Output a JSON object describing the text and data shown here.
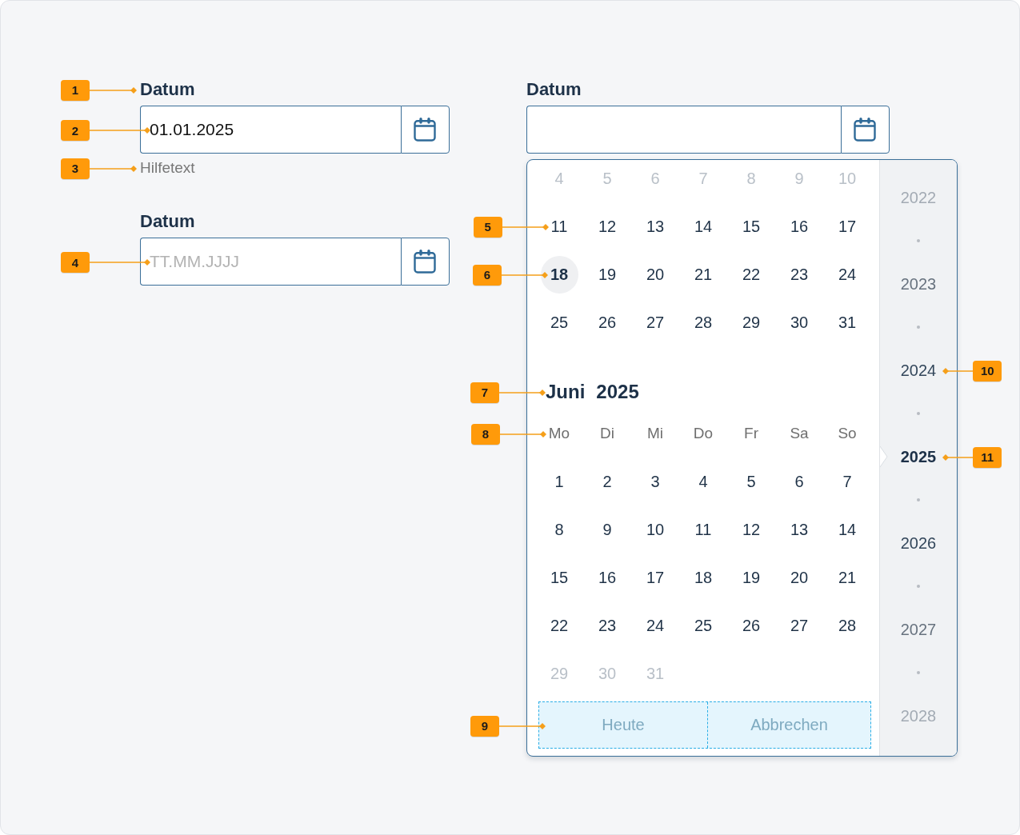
{
  "columns": [
    {
      "fields": [
        {
          "label": "Datum",
          "label_callout": "1",
          "value": "01.01.2025",
          "value_callout": "2",
          "helper": "Hilfetext",
          "helper_callout": "3"
        },
        {
          "label": "Datum",
          "placeholder": "TT.MM.JJJJ",
          "placeholder_callout": "4"
        }
      ]
    },
    {
      "fields": [
        {
          "label": "Datum",
          "calendar": {
            "months": [
              {
                "weeks": [
                  {
                    "faded": true,
                    "days": [
                      {
                        "label": "4",
                        "selected": false
                      },
                      {
                        "label": "5",
                        "selected": false
                      },
                      {
                        "label": "6",
                        "selected": false
                      },
                      {
                        "label": "7",
                        "selected": false
                      },
                      {
                        "label": "8",
                        "selected": false
                      },
                      {
                        "label": "9",
                        "selected": false
                      },
                      {
                        "label": "10",
                        "selected": false
                      }
                    ]
                  },
                  {
                    "faded": false,
                    "days": [
                      {
                        "label": "11",
                        "selected": false,
                        "callout": "5"
                      },
                      {
                        "label": "12",
                        "selected": false
                      },
                      {
                        "label": "13",
                        "selected": false
                      },
                      {
                        "label": "14",
                        "selected": false
                      },
                      {
                        "label": "15",
                        "selected": false
                      },
                      {
                        "label": "16",
                        "selected": false
                      },
                      {
                        "label": "17",
                        "selected": false
                      }
                    ]
                  },
                  {
                    "faded": false,
                    "days": [
                      {
                        "label": "18",
                        "selected": true,
                        "callout": "6"
                      },
                      {
                        "label": "19",
                        "selected": false
                      },
                      {
                        "label": "20",
                        "selected": false
                      },
                      {
                        "label": "21",
                        "selected": false
                      },
                      {
                        "label": "22",
                        "selected": false
                      },
                      {
                        "label": "23",
                        "selected": false
                      },
                      {
                        "label": "24",
                        "selected": false
                      }
                    ]
                  },
                  {
                    "faded": false,
                    "days": [
                      {
                        "label": "25",
                        "selected": false
                      },
                      {
                        "label": "26",
                        "selected": false
                      },
                      {
                        "label": "27",
                        "selected": false
                      },
                      {
                        "label": "28",
                        "selected": false
                      },
                      {
                        "label": "29",
                        "selected": false
                      },
                      {
                        "label": "30",
                        "selected": false
                      },
                      {
                        "label": "31",
                        "selected": false
                      }
                    ]
                  }
                ]
              },
              {
                "month": "Juni",
                "year": "2025",
                "title_callout": "7",
                "weekdays": [
                  "Mo",
                  "Di",
                  "Mi",
                  "Do",
                  "Fr",
                  "Sa",
                  "So"
                ],
                "weekdays_callout": "8",
                "weeks": [
                  {
                    "faded": false,
                    "days": [
                      {
                        "label": "1",
                        "selected": false
                      },
                      {
                        "label": "2",
                        "selected": false
                      },
                      {
                        "label": "3",
                        "selected": false
                      },
                      {
                        "label": "4",
                        "selected": false
                      },
                      {
                        "label": "5",
                        "selected": false
                      },
                      {
                        "label": "6",
                        "selected": false
                      },
                      {
                        "label": "7",
                        "selected": false
                      }
                    ]
                  },
                  {
                    "faded": false,
                    "days": [
                      {
                        "label": "8",
                        "selected": false
                      },
                      {
                        "label": "9",
                        "selected": false
                      },
                      {
                        "label": "10",
                        "selected": false
                      },
                      {
                        "label": "11",
                        "selected": false
                      },
                      {
                        "label": "12",
                        "selected": false
                      },
                      {
                        "label": "13",
                        "selected": false
                      },
                      {
                        "label": "14",
                        "selected": false
                      }
                    ]
                  },
                  {
                    "faded": false,
                    "days": [
                      {
                        "label": "15",
                        "selected": false
                      },
                      {
                        "label": "16",
                        "selected": false
                      },
                      {
                        "label": "17",
                        "selected": false
                      },
                      {
                        "label": "18",
                        "selected": false
                      },
                      {
                        "label": "19",
                        "selected": false
                      },
                      {
                        "label": "20",
                        "selected": false
                      },
                      {
                        "label": "21",
                        "selected": false
                      }
                    ]
                  },
                  {
                    "faded": false,
                    "days": [
                      {
                        "label": "22",
                        "selected": false
                      },
                      {
                        "label": "23",
                        "selected": false
                      },
                      {
                        "label": "24",
                        "selected": false
                      },
                      {
                        "label": "25",
                        "selected": false
                      },
                      {
                        "label": "26",
                        "selected": false
                      },
                      {
                        "label": "27",
                        "selected": false
                      },
                      {
                        "label": "28",
                        "selected": false
                      }
                    ]
                  },
                  {
                    "faded": true,
                    "days": [
                      {
                        "label": "29",
                        "selected": false
                      },
                      {
                        "label": "30",
                        "selected": false
                      },
                      {
                        "label": "31",
                        "selected": false
                      }
                    ]
                  }
                ]
              }
            ],
            "buttons": [
              "Heute",
              "Abbrechen"
            ],
            "buttons_callout": "9",
            "years": [
              {
                "label": "2022",
                "selected": false
              },
              {
                "label": "2023",
                "selected": false
              },
              {
                "label": "2024",
                "selected": false,
                "callout": "10"
              },
              {
                "label": "2025",
                "selected": true,
                "callout": "11"
              },
              {
                "label": "2026",
                "selected": false
              },
              {
                "label": "2027",
                "selected": false
              },
              {
                "label": "2028",
                "selected": false
              }
            ]
          }
        }
      ]
    }
  ]
}
